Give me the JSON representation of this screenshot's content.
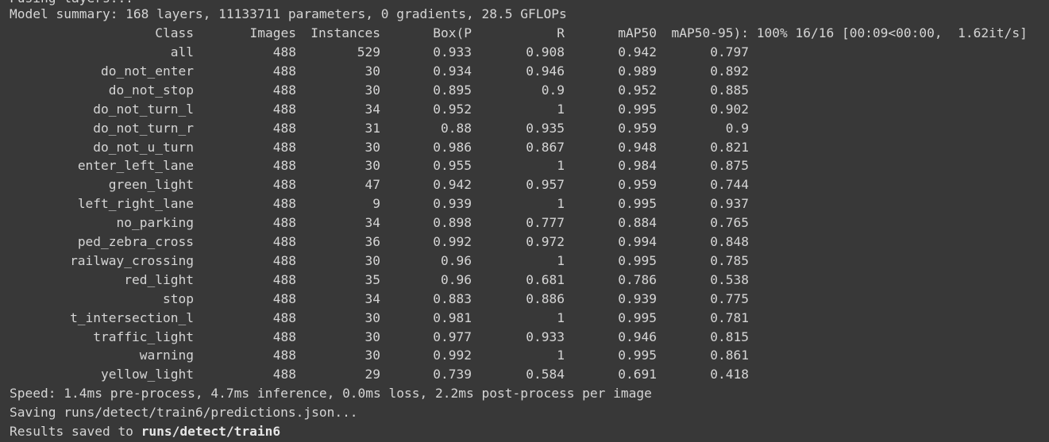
{
  "output": {
    "cut_line": "Fusing layers...",
    "summary": "Model summary: 168 layers, 11133711 parameters, 0 gradients, 28.5 GFLOPs",
    "header": {
      "class": "Class",
      "images": "Images",
      "instances": "Instances",
      "box_p": "Box(P",
      "r": "R",
      "map50": "mAP50",
      "map50_95": "mAP50-95):",
      "progress": " 100% 16/16 [00:09<00:00,  1.62it/s]"
    },
    "rows": [
      {
        "class": "all",
        "images": "488",
        "instances": "529",
        "box_p": "0.933",
        "r": "0.908",
        "map50": "0.942",
        "map50_95": "0.797"
      },
      {
        "class": "do_not_enter",
        "images": "488",
        "instances": "30",
        "box_p": "0.934",
        "r": "0.946",
        "map50": "0.989",
        "map50_95": "0.892"
      },
      {
        "class": "do_not_stop",
        "images": "488",
        "instances": "30",
        "box_p": "0.895",
        "r": "0.9",
        "map50": "0.952",
        "map50_95": "0.885"
      },
      {
        "class": "do_not_turn_l",
        "images": "488",
        "instances": "34",
        "box_p": "0.952",
        "r": "1",
        "map50": "0.995",
        "map50_95": "0.902"
      },
      {
        "class": "do_not_turn_r",
        "images": "488",
        "instances": "31",
        "box_p": "0.88",
        "r": "0.935",
        "map50": "0.959",
        "map50_95": "0.9"
      },
      {
        "class": "do_not_u_turn",
        "images": "488",
        "instances": "30",
        "box_p": "0.986",
        "r": "0.867",
        "map50": "0.948",
        "map50_95": "0.821"
      },
      {
        "class": "enter_left_lane",
        "images": "488",
        "instances": "30",
        "box_p": "0.955",
        "r": "1",
        "map50": "0.984",
        "map50_95": "0.875"
      },
      {
        "class": "green_light",
        "images": "488",
        "instances": "47",
        "box_p": "0.942",
        "r": "0.957",
        "map50": "0.959",
        "map50_95": "0.744"
      },
      {
        "class": "left_right_lane",
        "images": "488",
        "instances": "9",
        "box_p": "0.939",
        "r": "1",
        "map50": "0.995",
        "map50_95": "0.937"
      },
      {
        "class": "no_parking",
        "images": "488",
        "instances": "34",
        "box_p": "0.898",
        "r": "0.777",
        "map50": "0.884",
        "map50_95": "0.765"
      },
      {
        "class": "ped_zebra_cross",
        "images": "488",
        "instances": "36",
        "box_p": "0.992",
        "r": "0.972",
        "map50": "0.994",
        "map50_95": "0.848"
      },
      {
        "class": "railway_crossing",
        "images": "488",
        "instances": "30",
        "box_p": "0.96",
        "r": "1",
        "map50": "0.995",
        "map50_95": "0.785"
      },
      {
        "class": "red_light",
        "images": "488",
        "instances": "35",
        "box_p": "0.96",
        "r": "0.681",
        "map50": "0.786",
        "map50_95": "0.538"
      },
      {
        "class": "stop",
        "images": "488",
        "instances": "34",
        "box_p": "0.883",
        "r": "0.886",
        "map50": "0.939",
        "map50_95": "0.775"
      },
      {
        "class": "t_intersection_l",
        "images": "488",
        "instances": "30",
        "box_p": "0.981",
        "r": "1",
        "map50": "0.995",
        "map50_95": "0.781"
      },
      {
        "class": "traffic_light",
        "images": "488",
        "instances": "30",
        "box_p": "0.977",
        "r": "0.933",
        "map50": "0.946",
        "map50_95": "0.815"
      },
      {
        "class": "warning",
        "images": "488",
        "instances": "30",
        "box_p": "0.992",
        "r": "1",
        "map50": "0.995",
        "map50_95": "0.861"
      },
      {
        "class": "yellow_light",
        "images": "488",
        "instances": "29",
        "box_p": "0.739",
        "r": "0.584",
        "map50": "0.691",
        "map50_95": "0.418"
      }
    ],
    "speed": "Speed: 1.4ms pre-process, 4.7ms inference, 0.0ms loss, 2.2ms post-process per image",
    "saving": "Saving runs/detect/train6/predictions.json...",
    "results_prefix": "Results saved to ",
    "results_path": "runs/detect/train6"
  },
  "theme": {
    "background": "#383838",
    "text": "#d5d5d5"
  }
}
